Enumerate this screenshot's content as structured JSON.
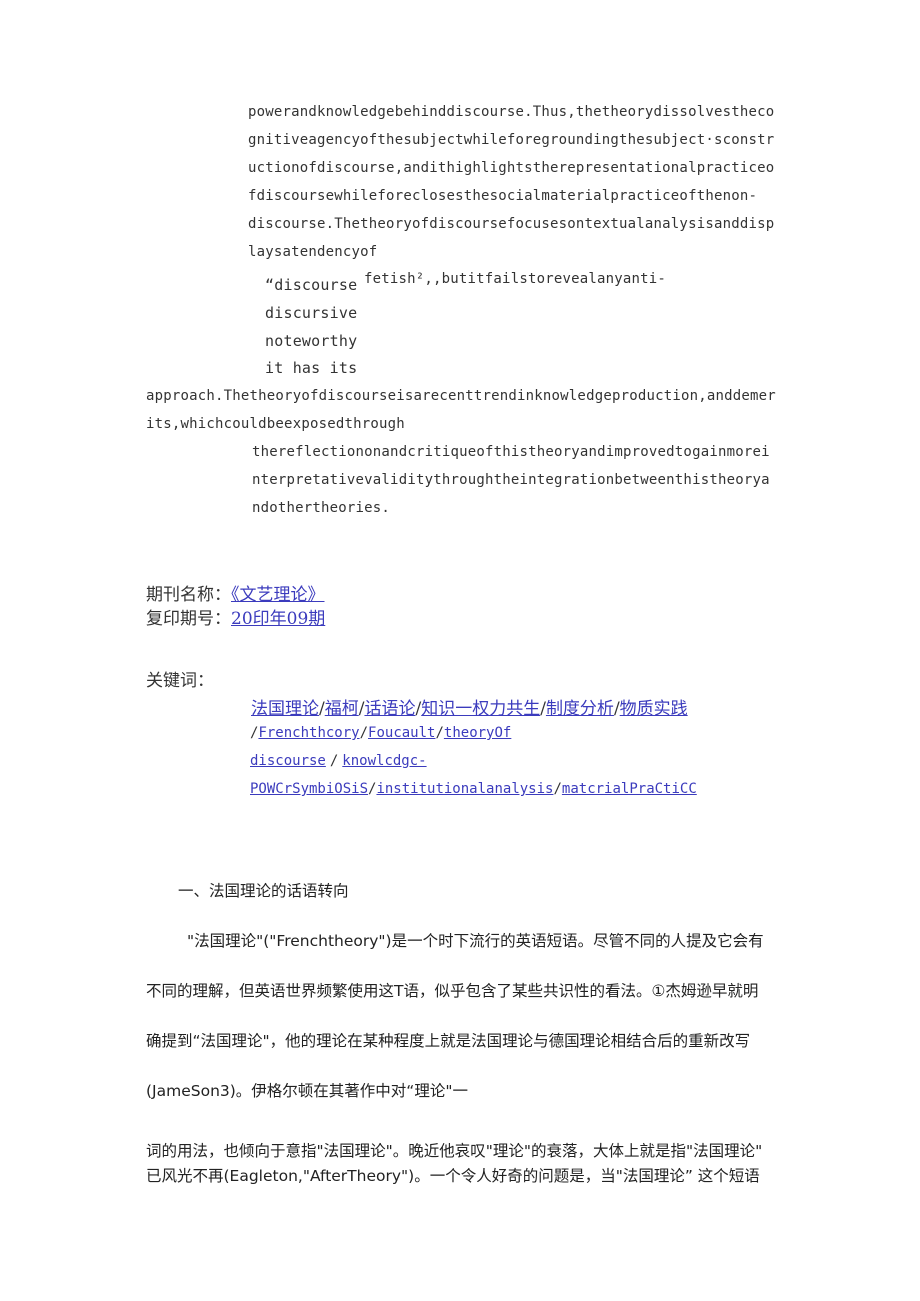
{
  "abstract_en": {
    "lines_a": [
      "powerandknowledgebehinddiscourse.Thus,thetheorydissolvesthecо",
      "gnitiveagencyofthesubjectwhileforegroundingthesubject·sconstr",
      "uctionofdiscourse,andithighlightstherepresentationalpracticeo",
      "fdiscoursewhileforeclosesthesocialmaterialpracticeofthenon-",
      "discourse.Thetheoryofdiscoursefocusesontextualanalysisanddisp",
      "laysatendencyof"
    ],
    "quote_open": "“discourse",
    "quote_rest": "fetish²,,butitfailstorevealanyanti-",
    "fragments": [
      "discursive",
      "noteworthy",
      "it has its"
    ],
    "lines_b": [
      "approach.Thetheoryofdiscourseisarecenttrendinknowledgeproduction,anddemer",
      "its,whichcouldbeexposedthrough"
    ],
    "lines_c": [
      "thereflectiononandcritiqueofthistheoryandimprovedtogainmorei",
      "nterpretativevaliditythroughtheintegrationbetweenthistheorya",
      "ndothertheories."
    ]
  },
  "meta": {
    "journal_label": "期刊名称：",
    "journal_value": "《文艺理论》",
    "issue_label": "复印期号：",
    "issue_value": "20印年09期",
    "keywords_label": "关键词："
  },
  "keywords": {
    "cn": [
      "法国理论",
      "福柯",
      "话语论",
      "知识一权力共生",
      "制度分析",
      "物质实践"
    ],
    "en": [
      "Frenchthcory",
      "Foucault",
      "theoryOf",
      "discourse",
      "knowlcdgc-",
      "POWCrSymbiOSiS",
      "institutionalanalysis",
      "matcrialPraCtiCC"
    ],
    "separator": "/"
  },
  "body": {
    "section_heading": "一、法国理论的话语转向",
    "paragraph_lines": [
      "\"法国理论\"(\"Frenchtheory\")是一个时下流行的英语短语。尽管不同的人提及它会有",
      "不同的理解，但英语世界频繁使用这T语，似乎包含了某些共识性的看法。①杰姆逊早就明",
      "确提到“法国理论\"，他的理论在某种程度上就是法国理论与德国理论相结合后的重新改写",
      "(JameSon3)。伊格尔顿在其著作中对“理论\"一"
    ],
    "paragraph2_lines": [
      "词的用法，也倾向于意指\"法国理论\"。晚近他哀叹\"理论\"的衰落，大体上就是指\"法国理论\"",
      "已风光不再(Eagleton,\"AfterTheory\")。一个令人好奇的问题是，当\"法国理论” 这个短语"
    ]
  }
}
